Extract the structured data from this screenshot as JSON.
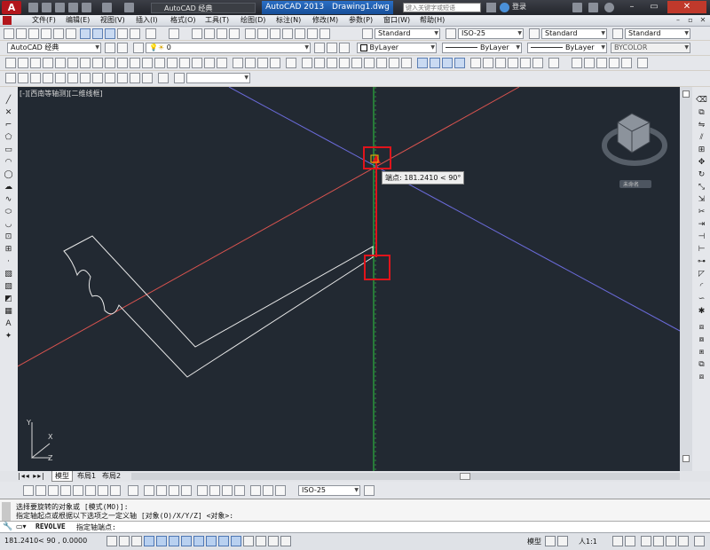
{
  "app": {
    "title": "AutoCAD 2013",
    "document": "Drawing1.dwg",
    "logo": "A",
    "workspace": "AutoCAD 经典",
    "search_placeholder": "键入关键字或短语",
    "signin": "登录"
  },
  "menu": [
    "文件(F)",
    "编辑(E)",
    "视图(V)",
    "插入(I)",
    "格式(O)",
    "工具(T)",
    "绘图(D)",
    "标注(N)",
    "修改(M)",
    "参数(P)",
    "窗口(W)",
    "帮助(H)"
  ],
  "styles_toolbar": {
    "text_style": "Standard",
    "dim_style": "ISO-25",
    "table_style": "Standard",
    "multileader_style": "Standard"
  },
  "layers_toolbar": {
    "workspace": "AutoCAD 经典",
    "layer": "0",
    "color": "ByLayer",
    "linetype": "ByLayer",
    "lineweight": "ByLayer",
    "plotstyle": "BYCOLOR"
  },
  "viewport_label": "[-][西南等轴测][二维线框]",
  "tooltip": "端点: 181.2410 < 90°",
  "viewcube": {
    "label": "未命名"
  },
  "ucs": {
    "x": "X",
    "y": "Y",
    "z": "Z"
  },
  "layout_tabs": [
    "模型",
    "布局1",
    "布局2"
  ],
  "dim_style_combo": "ISO-25",
  "command_history": [
    "选择要旋转的对象或 [模式(MO)]:",
    "指定轴起点或根据以下选项之一定义轴 [对象(O)/X/Y/Z] <对象>:"
  ],
  "command_prompt": {
    "name": "REVOLVE",
    "text": "指定轴端点:"
  },
  "status": {
    "coords": "181.2410<  90   ,  0.0000",
    "model": "模型",
    "scale": "人1:1"
  },
  "colors": {
    "canvas": "#222932",
    "highlight": "#e0141b",
    "x_axis": "#d9534f",
    "y_axis": "#2ecc40",
    "blue_line": "#6a6ad8"
  }
}
